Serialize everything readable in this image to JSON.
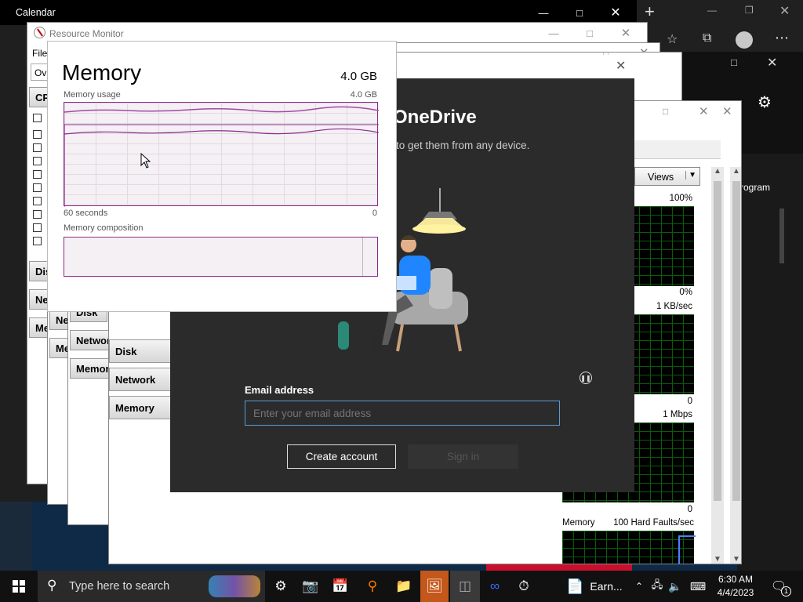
{
  "calendar": {
    "title": "Calendar"
  },
  "browser": {
    "new_tab": "+"
  },
  "resource_monitor": {
    "title": "Resource Monitor",
    "menu": {
      "file": "File"
    },
    "tab_partial": "Ov",
    "panels": {
      "cpu": "CPU",
      "disk": "Disk",
      "network": "Network",
      "memory": "Memory"
    },
    "views_label": "Views",
    "graphs": [
      {
        "top_label": "100%",
        "bottom_label": "0%"
      },
      {
        "top_label": "1 KB/sec",
        "bottom_label": "0"
      },
      {
        "top_label": "1 Mbps",
        "bottom_label": "0"
      },
      {
        "title": "Memory",
        "top_label": "100 Hard Faults/sec"
      }
    ]
  },
  "behind_panels": {
    "disk": "Disk",
    "network": "Network",
    "memory": "Memory"
  },
  "onedrive": {
    "title_partial": "OneDrive",
    "subtitle_partial": "to get them from any device.",
    "email_label": "Email address",
    "email_placeholder": "Enter your email address",
    "create_account": "Create account",
    "sign_in": "Sign in"
  },
  "right_partial_text": "rogram",
  "memory_widget": {
    "title": "Memory",
    "capacity": "4.0 GB",
    "usage_label": "Memory usage",
    "usage_max": "4.0 GB",
    "time_left": "60 seconds",
    "time_right": "0",
    "composition_label": "Memory composition"
  },
  "taskbar": {
    "search_placeholder": "Type here to search",
    "app_label": "Earn...",
    "time": "6:30 AM",
    "date": "4/4/2023",
    "notification_count": "1"
  }
}
